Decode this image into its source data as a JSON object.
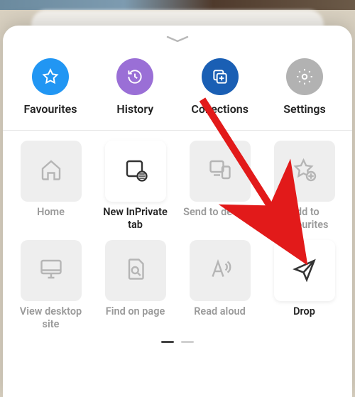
{
  "topActions": {
    "favourites": {
      "label": "Favourites",
      "color": "#2196f3"
    },
    "history": {
      "label": "History",
      "color": "#9a6fd6"
    },
    "collections": {
      "label": "Collections",
      "color": "#1a5fb4"
    },
    "settings": {
      "label": "Settings",
      "color": "#b2b2b2"
    }
  },
  "grid": {
    "home": {
      "label": "Home"
    },
    "newInPrivate": {
      "label": "New InPrivate tab"
    },
    "sendToDevices": {
      "label": "Send to devices"
    },
    "addFavourites": {
      "label": "Add to Favourites"
    },
    "viewDesktop": {
      "label": "View desktop site"
    },
    "findOnPage": {
      "label": "Find on page"
    },
    "readAloud": {
      "label": "Read aloud"
    },
    "drop": {
      "label": "Drop"
    }
  },
  "pager": {
    "pageCount": 2,
    "currentPage": 1
  },
  "annotation": {
    "arrowPointsTo": "drop"
  }
}
